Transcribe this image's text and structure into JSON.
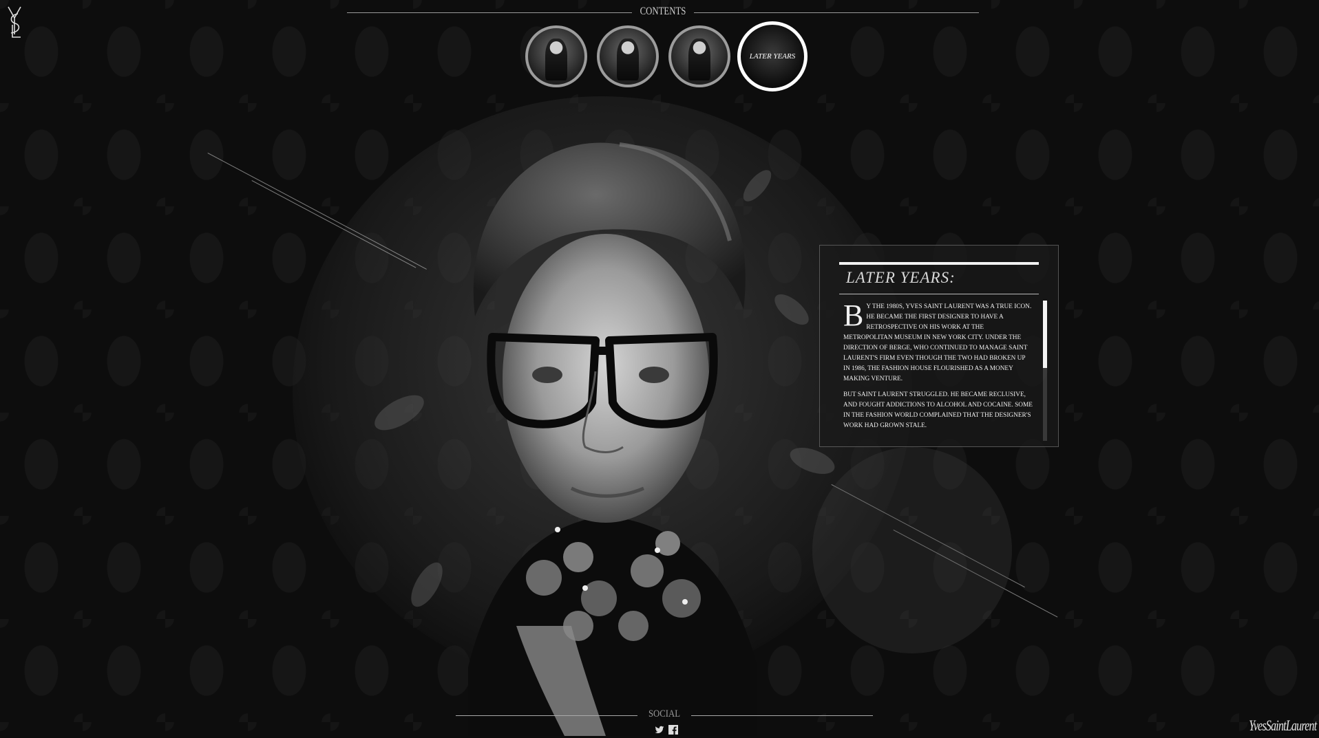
{
  "logo": {
    "monogram": "YSL"
  },
  "nav": {
    "heading": "CONTENTS",
    "items": [
      {
        "id": "early-life",
        "icon": "portrait-thumbnail"
      },
      {
        "id": "career",
        "icon": "portrait-thumbnail"
      },
      {
        "id": "middle-years",
        "icon": "portrait-thumbnail"
      },
      {
        "id": "later-years",
        "caption": "LATER YEARS",
        "active": true
      }
    ]
  },
  "panel": {
    "title": "LATER YEARS:",
    "dropcap": "B",
    "para1": "y the 1980s, Yves Saint Laurent was a true icon. He became the first designer to have a retrospective on his work at the Metropolitan Museum in New York City. Under the direction of Berge, who continued to manage Saint Laurent's firm even though the two had broken up in 1986, the fashion house flourished as a money making venture.",
    "para2": "But Saint Laurent struggled. He became reclusive, and fought addictions to alcohol and cocaine. Some in the fashion world complained that the designer's work had grown stale.",
    "scroll_position": 0
  },
  "social": {
    "heading": "SOCIAL",
    "icons": [
      "twitter-icon",
      "facebook-icon"
    ]
  },
  "brand": {
    "wordmark": "YvesSaintLaurent"
  }
}
